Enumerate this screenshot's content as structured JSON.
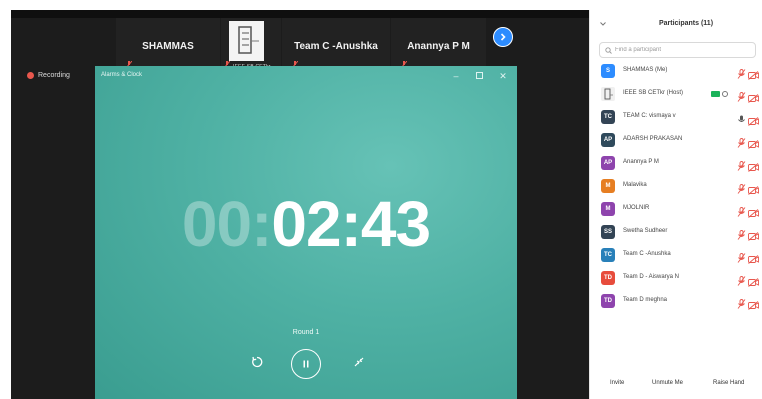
{
  "meeting": {
    "tiles": [
      {
        "label": "SHAMMAS"
      },
      {
        "caption": "IEEE SB CETkr"
      },
      {
        "label": "Team C -Anushka"
      },
      {
        "label": "Anannya P M"
      }
    ],
    "recording_label": "Recording"
  },
  "clock": {
    "title": "Alarms & Clock",
    "timer_hours": "00:",
    "timer_rest": "02:43",
    "round_label": "Round 1"
  },
  "participants": {
    "title": "Participants (11)",
    "search_placeholder": "Find a participant",
    "list": [
      {
        "initials": "S",
        "name": "SHAMMAS (Me)",
        "color": "#2d8cff"
      },
      {
        "initials": "",
        "name": "IEEE SB CETkr (Host)",
        "color": "#f0f0f0"
      },
      {
        "initials": "TC",
        "name": "TEAM C: vismaya v",
        "color": "#334455"
      },
      {
        "initials": "AP",
        "name": "ADARSH PRAKASAN",
        "color": "#2f4a5c"
      },
      {
        "initials": "AP",
        "name": "Anannya P M",
        "color": "#8e44ad"
      },
      {
        "initials": "M",
        "name": "Malavika",
        "color": "#e67e22"
      },
      {
        "initials": "M",
        "name": "MJOLNIR",
        "color": "#8e44ad"
      },
      {
        "initials": "SS",
        "name": "Swetha Sudheer",
        "color": "#334455"
      },
      {
        "initials": "TC",
        "name": "Team C -Anushka",
        "color": "#2980b9"
      },
      {
        "initials": "TD",
        "name": "Team D - Aiswarya N",
        "color": "#e74c3c"
      },
      {
        "initials": "TD",
        "name": "Team D meghna",
        "color": "#8e44ad"
      }
    ],
    "footer": {
      "invite": "Invite",
      "unmute_me": "Unmute Me",
      "raise_hand": "Raise Hand"
    }
  }
}
